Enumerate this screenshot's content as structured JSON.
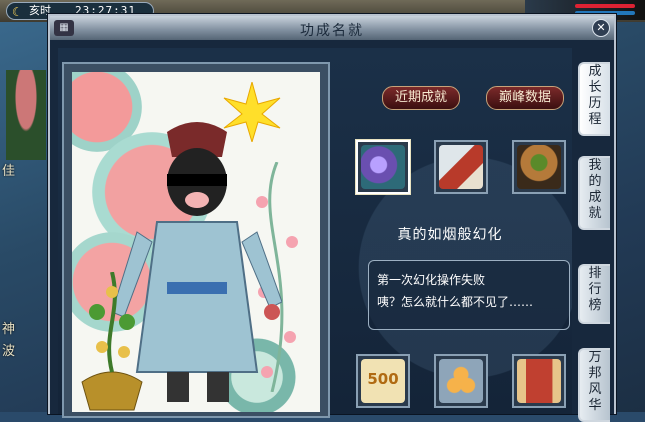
{
  "hud": {
    "hour_label": "亥时",
    "clock": "23:27:31",
    "left_fragments": [
      "佳",
      "神",
      "波"
    ]
  },
  "window": {
    "title": "功成名就",
    "close_symbol": "✕"
  },
  "buttons": {
    "recent": "近期成就",
    "peak": "巅峰数据"
  },
  "achievement": {
    "title": "真的如烟般幻化",
    "desc_line1": "第一次幻化操作失败",
    "desc_line2": "咦？怎么就什么都不见了……"
  },
  "item_slots_top": [
    {
      "name": "purple-crystal-item",
      "color": "#6a4fb0",
      "selected": true
    },
    {
      "name": "half-price-tag-item",
      "color": "#b83a2a",
      "selected": false
    },
    {
      "name": "seed-pot-item",
      "color": "#8a5a2a",
      "selected": false
    }
  ],
  "item_slots_bottom": [
    {
      "name": "coin-500-item",
      "label": "500",
      "color": "#e8c05a"
    },
    {
      "name": "orange-beads-item",
      "color": "#f0a040"
    },
    {
      "name": "scroll-item",
      "color": "#c04030"
    }
  ],
  "tabs": [
    {
      "chars": [
        "成",
        "长",
        "历",
        "程"
      ],
      "active": true
    },
    {
      "chars": [
        "我",
        "的",
        "成",
        "就"
      ],
      "active": false
    },
    {
      "chars": [
        "排",
        "行",
        "榜"
      ],
      "active": false
    },
    {
      "chars": [
        "万",
        "邦",
        "风",
        "华"
      ],
      "active": false
    }
  ],
  "colors": {
    "button_red": "#7b2a2a",
    "window_bg": "#17283d"
  }
}
